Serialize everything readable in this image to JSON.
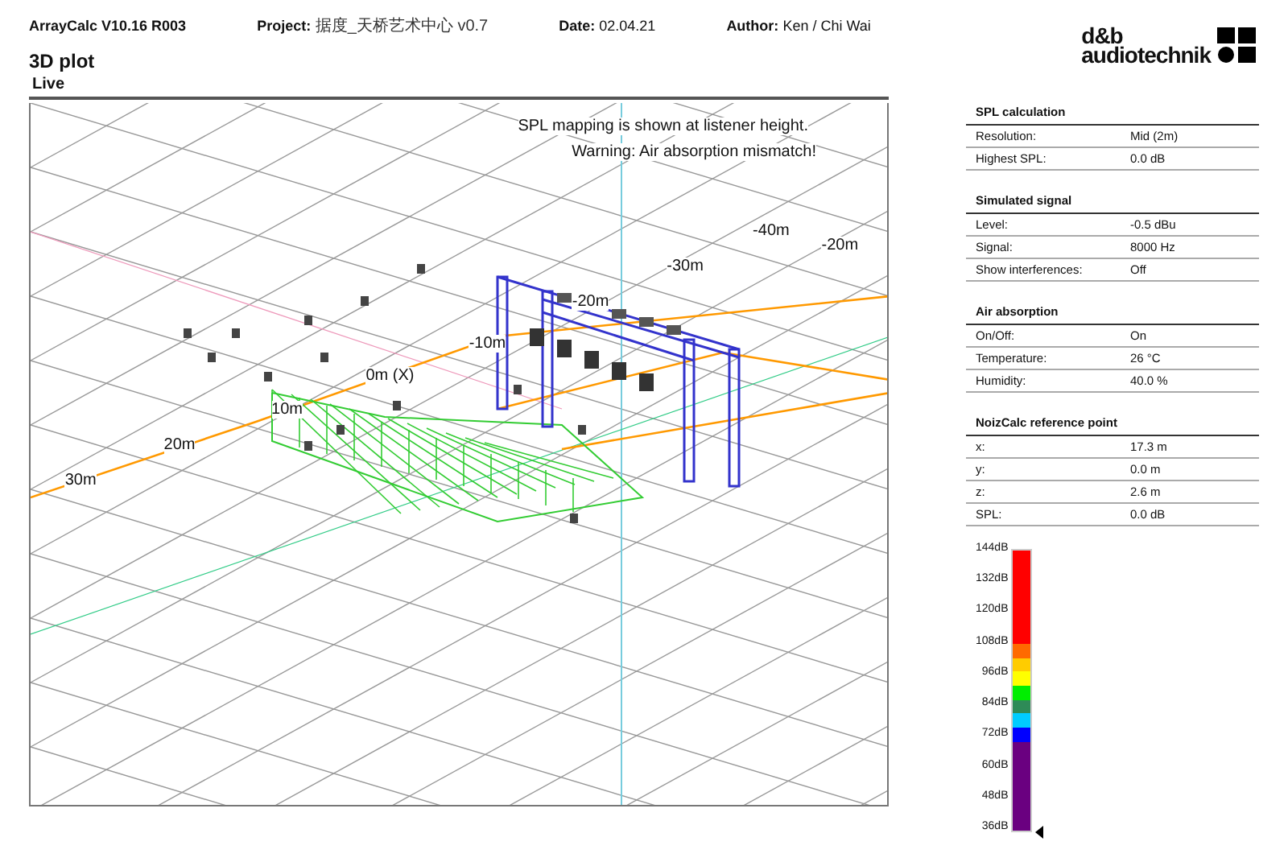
{
  "header": {
    "fields": [
      {
        "label": "ArrayCalc V10.16 R003"
      },
      {
        "label": "Project:",
        "value": "据度_天桥艺术中心 v0.7"
      },
      {
        "label": "Date:",
        "value": "02.04.21"
      },
      {
        "label": "Author:",
        "value": "Ken / Chi Wai"
      }
    ],
    "title": "3D plot",
    "logo": {
      "line1": "d&b",
      "line2": "audiotechnik"
    }
  },
  "plot": {
    "title": "Live",
    "messages": [
      "SPL mapping is shown at listener height.",
      "Warning: Air absorption mismatch!"
    ],
    "axis_labels": [
      "-40m",
      "-20m",
      "-30m",
      "-20m",
      "-10m",
      "0m (X)",
      "10m",
      "20m",
      "30m"
    ]
  },
  "sections": [
    {
      "title": "SPL calculation",
      "rows": [
        {
          "label": "Resolution:",
          "value": "Mid (2m)"
        },
        {
          "label": "Highest SPL:",
          "value": "0.0 dB"
        }
      ]
    },
    {
      "title": "Simulated signal",
      "rows": [
        {
          "label": "Level:",
          "value": "-0.5 dBu"
        },
        {
          "label": "Signal:",
          "value": "8000 Hz"
        },
        {
          "label": "Show interferences:",
          "value": "Off"
        }
      ]
    },
    {
      "title": "Air absorption",
      "rows": [
        {
          "label": "On/Off:",
          "value": "On"
        },
        {
          "label": "Temperature:",
          "value": "26 °C"
        },
        {
          "label": "Humidity:",
          "value": "40.0 %"
        }
      ]
    },
    {
      "title": "NoizCalc reference point",
      "rows": [
        {
          "label": "x:",
          "value": "17.3 m"
        },
        {
          "label": "y:",
          "value": "0.0 m"
        },
        {
          "label": "z:",
          "value": "2.6 m"
        },
        {
          "label": "SPL:",
          "value": "0.0 dB"
        }
      ]
    }
  ],
  "color_scale": {
    "ticks": [
      "144dB",
      "132dB",
      "120dB",
      "108dB",
      "96dB",
      "84dB",
      "72dB",
      "60dB",
      "48dB",
      "36dB"
    ],
    "bands": [
      {
        "color": "#ff0000"
      },
      {
        "color": "#ff6a00"
      },
      {
        "color": "#ffcc00"
      },
      {
        "color": "#ffff00"
      },
      {
        "color": "#00ee00"
      },
      {
        "color": "#2e8b57"
      },
      {
        "color": "#00ccff"
      },
      {
        "color": "#0000ff"
      },
      {
        "color": "#6a0080"
      }
    ]
  }
}
